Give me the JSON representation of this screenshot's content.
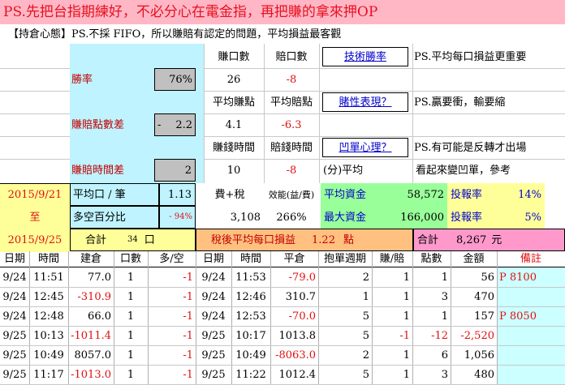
{
  "title": "PS.先把台指期練好，不必分心在電金指，再把賺的拿來押OP",
  "subtitle": "【持倉心態】PS.不採 FIFO，所以賺賠有認定的問題，平均損益最客觀",
  "summary": {
    "win_rate_label": "勝率",
    "win_rate": "76%",
    "win_count_label": "賺口數",
    "win_count": "26",
    "loss_count_label": "賠口數",
    "loss_count": "-8",
    "tech_win_link": "技術勝率",
    "note1": "PS.平均每口損益更重要",
    "point_diff_label": "賺賠點數差",
    "point_diff_sign": "-",
    "point_diff": "2.2",
    "avg_win_pts_label": "平均賺點",
    "avg_win_pts": "4.1",
    "avg_loss_pts_label": "平均賠點",
    "avg_loss_pts": "-6.3",
    "gambling_link": "賭性表現？",
    "note2": "PS.贏要衝，輸要縮",
    "win_time_label": "賺錢時間",
    "loss_time_label": "賠錢時間",
    "reverse_link": "凹單心理？",
    "note3": "PS.有可能是反轉才出場",
    "time_diff_label": "賺賠時間差",
    "time_diff": "2",
    "win_time": "10",
    "loss_time": "-8",
    "avg_unit": "(分)平均",
    "note4": "看起來變凹單，參考"
  },
  "period": {
    "start": "2015/9/21",
    "to": "至",
    "end": "2015/9/25"
  },
  "stats": {
    "avg_lot_label": "平均口 / 筆",
    "avg_lot": "1.13",
    "fee_tax_label": "費+稅",
    "efficiency_label": "效能(益/費)",
    "avg_capital_label": "平均資金",
    "avg_capital": "58,572",
    "roi_label": "投報率",
    "roi": "14%",
    "long_short_label": "多空百分比",
    "long_short": "- 94%",
    "fee_tax": "3,108",
    "efficiency": "266%",
    "max_capital_label": "最大資金",
    "max_capital": "166,000",
    "roi2_label": "投報率",
    "roi2": "5%",
    "total_label": "合計",
    "total_lots": "34",
    "lot_unit": "口",
    "after_tax_label": "稅後平均每口損益",
    "after_tax_value": "1.22",
    "pts_unit": "點",
    "total2_label": "合計",
    "total_amount": "8,267",
    "yuan": "元"
  },
  "table": {
    "headers": [
      "日期",
      "時間",
      "建倉",
      "口數",
      "多/空",
      "日期",
      "時間",
      "平倉",
      "抱單週期",
      "賺/賠",
      "點數",
      "金額",
      "備註"
    ],
    "rows": [
      [
        "9/24",
        "11:51",
        "77.0",
        "1",
        "-1",
        "9/24",
        "11:53",
        "-79.0",
        "2",
        "1",
        "1",
        "56",
        "P 8100"
      ],
      [
        "9/24",
        "12:45",
        "-310.9",
        "1",
        "-1",
        "9/24",
        "12:46",
        "310.7",
        "1",
        "1",
        "3",
        "470",
        ""
      ],
      [
        "9/24",
        "12:48",
        "66.0",
        "1",
        "-1",
        "9/24",
        "12:53",
        "-70.0",
        "5",
        "1",
        "1",
        "157",
        "P 8050"
      ],
      [
        "9/25",
        "10:13",
        "-1011.4",
        "1",
        "-1",
        "9/25",
        "10:17",
        "1013.8",
        "5",
        "-1",
        "-12",
        "-2,520",
        ""
      ],
      [
        "9/25",
        "10:49",
        "8057.0",
        "1",
        "-1",
        "9/25",
        "10:49",
        "-8063.0",
        "2",
        "1",
        "6",
        "1,056",
        ""
      ],
      [
        "9/25",
        "11:17",
        "-1013.0",
        "1",
        "-1",
        "9/25",
        "11:22",
        "1012.4",
        "5",
        "1",
        "3",
        "480",
        ""
      ]
    ]
  }
}
